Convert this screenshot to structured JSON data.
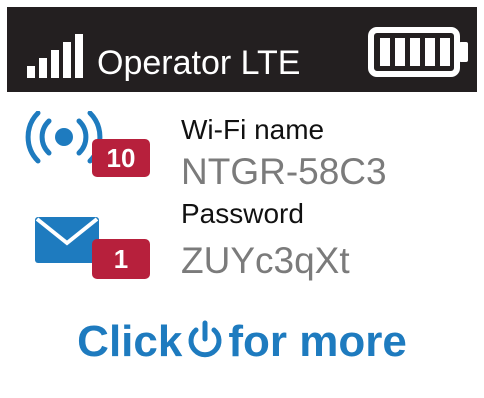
{
  "status_bar": {
    "operator_label": "Operator LTE",
    "signal_level": 1.0,
    "battery_level": 1.0
  },
  "wifi": {
    "icon": "wifi-broadcast-icon",
    "connected_count": "10",
    "label": "Wi-Fi name",
    "value": "NTGR-58C3"
  },
  "password": {
    "icon": "mail-icon",
    "message_count": "1",
    "label": "Password",
    "value": "ZUYc3qXt"
  },
  "footer": {
    "text_before": "Click",
    "icon": "power-icon",
    "text_after": "for more"
  },
  "colors": {
    "status_bar_bg": "#231f20",
    "accent_blue": "#1e7bbf",
    "badge_red": "#b7203c",
    "value_gray": "#7b7b7b"
  }
}
